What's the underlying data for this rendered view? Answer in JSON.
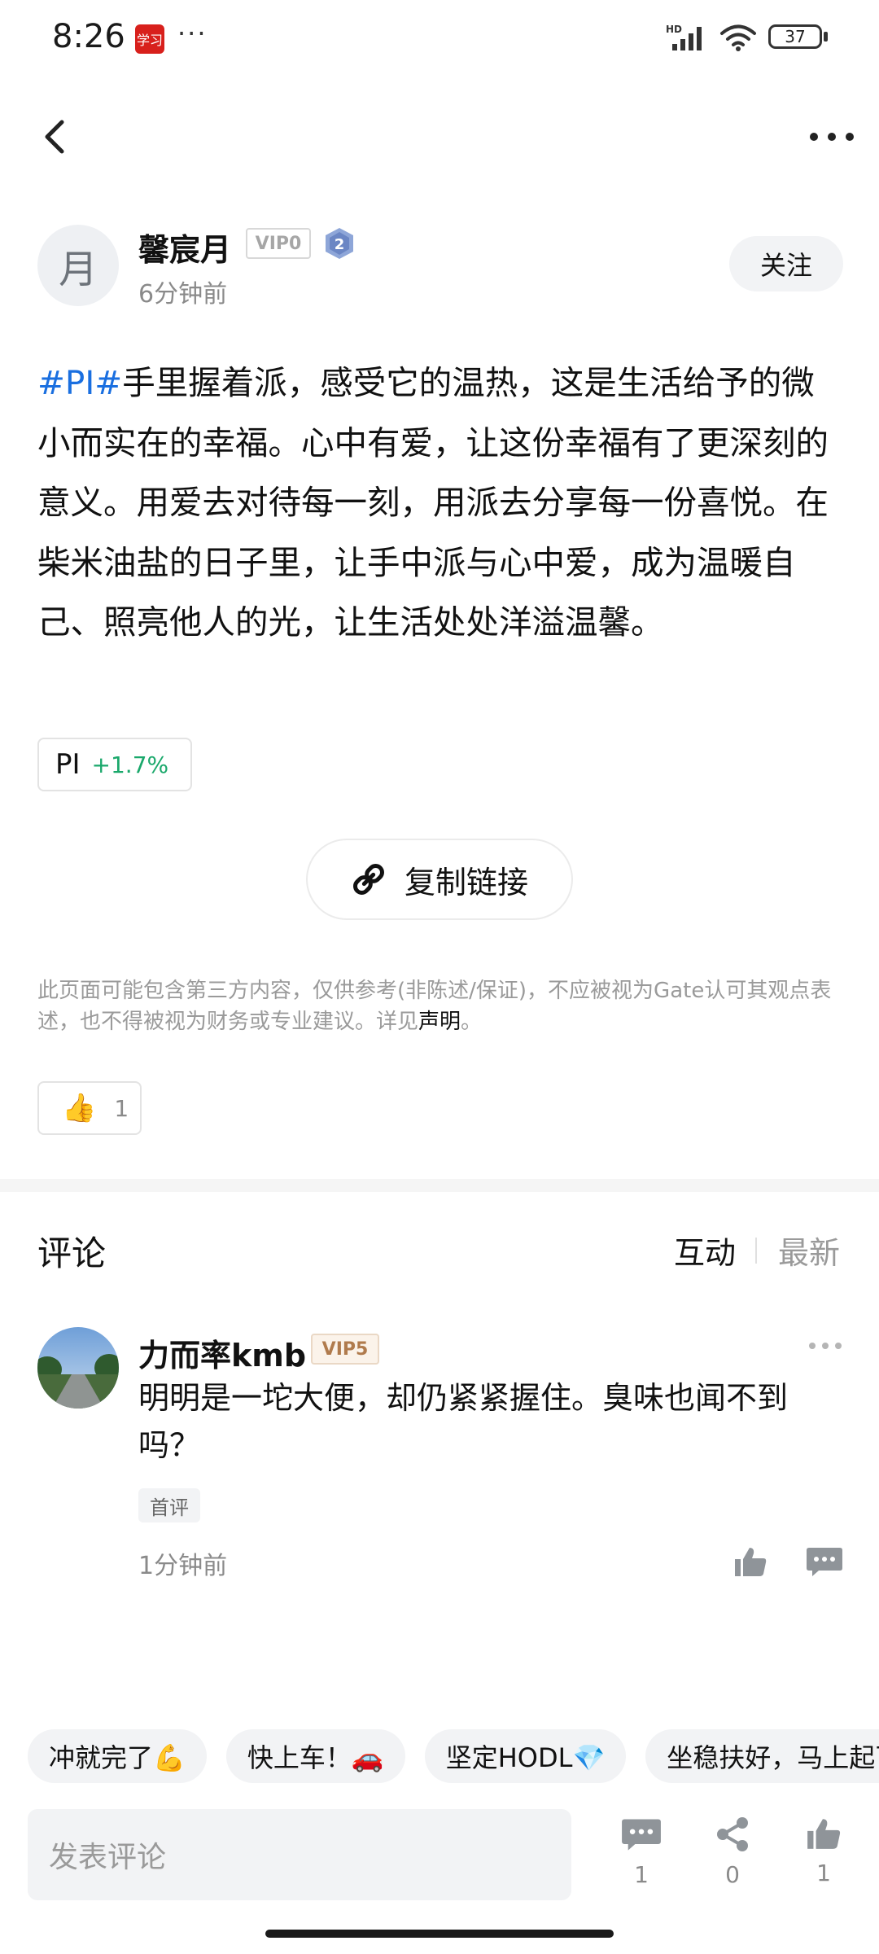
{
  "status_bar": {
    "time": "8:26",
    "app_badge": "学习",
    "more": "···",
    "battery": "37",
    "icons": [
      "hd-signal-icon",
      "wifi-icon",
      "battery-icon"
    ]
  },
  "nav": {
    "back_icon": "chevron-left-icon",
    "more_icon": "more-dots-icon"
  },
  "author": {
    "avatar_char": "月",
    "name": "馨宸月",
    "vip": "VIP0",
    "level": "2",
    "time": "6分钟前",
    "follow_label": "关注"
  },
  "post": {
    "hashtag": "#PI#",
    "text": "手里握着派，感受它的温热，这是生活给予的微小而实在的幸福。心中有爱，让这份幸福有了更深刻的意义。用爱去对待每一刻，用派去分享每一份喜悦。在柴米油盐的日子里，让手中派与心中爱，成为温暖自己、照亮他人的光，让生活处处洋溢温馨。"
  },
  "ticker": {
    "symbol": "PI",
    "change": "+1.7%",
    "change_color": "#1aa86b"
  },
  "copy_link": {
    "label": "复制链接",
    "icon": "link-icon"
  },
  "disclaimer": {
    "text": "此页面可能包含第三方内容，仅供参考(非陈述/保证)，不应被视为Gate认可其观点表述，也不得被视为财务或专业建议。详见",
    "link": "声明",
    "end": "。"
  },
  "reaction": {
    "emoji": "👍",
    "count": "1"
  },
  "comments": {
    "title": "评论",
    "tabs": [
      {
        "label": "互动",
        "active": true
      },
      {
        "label": "最新",
        "active": false
      }
    ],
    "items": [
      {
        "name": "力而率kmb",
        "vip": "VIP5",
        "text": "明明是一坨大便，却仍紧紧握住。臭味也闻不到吗？",
        "tag": "首评",
        "time": "1分钟前"
      }
    ]
  },
  "quick_replies": [
    "冲就完了💪",
    "快上车！🚗",
    "坚定HODL💎",
    "坐稳扶好，马上起飞🚀"
  ],
  "bottom_bar": {
    "input_placeholder": "发表评论",
    "comment_count": "1",
    "share_count": "0",
    "like_count": "1"
  },
  "colors": {
    "link_blue": "#1a6fe0",
    "up_green": "#1aa86b",
    "muted_gray": "#8a8a8a",
    "icon_gray": "#8f9499"
  }
}
